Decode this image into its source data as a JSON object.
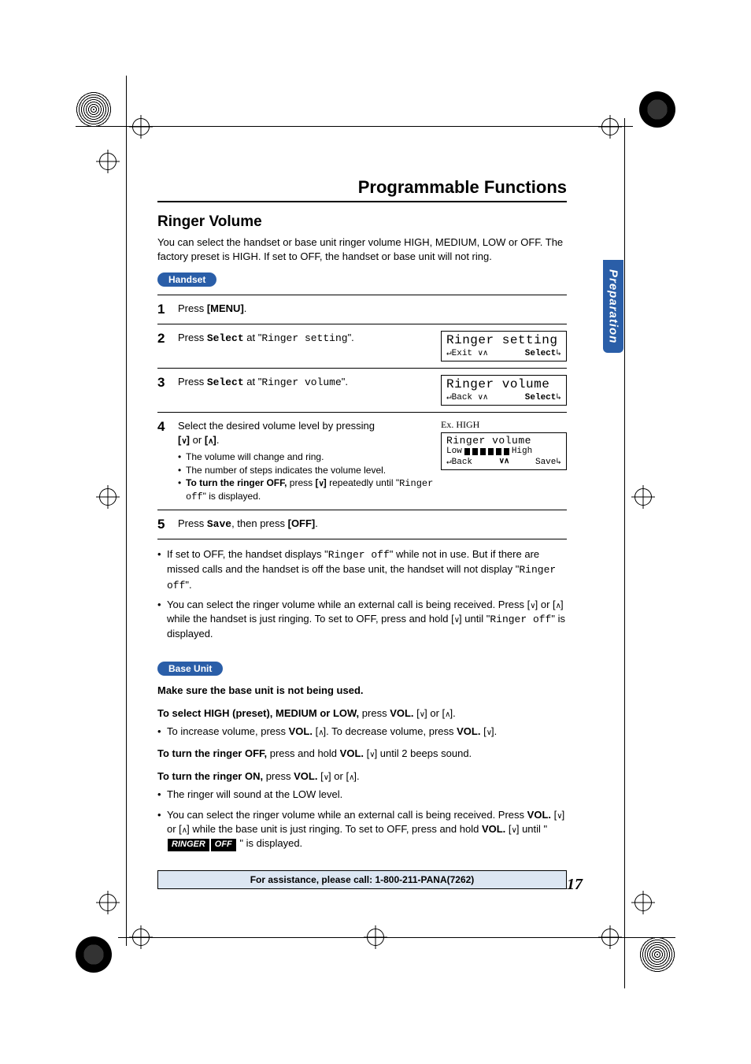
{
  "header": {
    "title": "Programmable Functions"
  },
  "side_tab": "Preparation",
  "section": {
    "title": "Ringer Volume",
    "intro": "You can select the handset or base unit ringer volume HIGH, MEDIUM, LOW or OFF. The factory preset is HIGH. If set to OFF, the handset or base unit will not ring."
  },
  "pill_handset": "Handset",
  "steps": {
    "s1": {
      "num": "1",
      "t1": "Press ",
      "b1": "[MENU]",
      "t2": "."
    },
    "s2": {
      "num": "2",
      "t1": "Press ",
      "b1": "Select",
      "t2": " at \"",
      "m1": "Ringer setting",
      "t3": "\".",
      "lcd_title": "Ringer setting",
      "lcd_left": "Exit",
      "lcd_right": "Select"
    },
    "s3": {
      "num": "3",
      "t1": "Press ",
      "b1": "Select",
      "t2": " at \"",
      "m1": "Ringer volume",
      "t3": "\".",
      "lcd_title": "Ringer volume",
      "lcd_left": "Back",
      "lcd_right": "Select"
    },
    "s4": {
      "num": "4",
      "line1a": "Select the desired volume level by pressing ",
      "line1b": "[",
      "line1c": "]",
      "line1_or": " or ",
      "sub1": "The volume will change and ring.",
      "sub2": "The number of steps indicates the volume level.",
      "sub3a": "To turn the ringer OFF,",
      "sub3b": " press ",
      "sub3c": " repeatedly until \"",
      "sub3d": "Ringer off",
      "sub3e": "\" is displayed.",
      "ex": "Ex. HIGH",
      "lcd_title": "Ringer volume",
      "lcd_low": "Low",
      "lcd_high": "High",
      "lcd_left": "Back",
      "lcd_right": "Save"
    },
    "s5": {
      "num": "5",
      "t1": "Press ",
      "b1": "Save",
      "t2": ", then press ",
      "b2": "[OFF]",
      "t3": "."
    }
  },
  "notes": {
    "n1a": "If set to OFF, the handset displays \"",
    "n1b": "Ringer off",
    "n1c": "\" while not in use. But if there are missed calls and the handset is off the base unit, the handset will not display \"",
    "n1d": "Ringer off",
    "n1e": "\".",
    "n2a": "You can select the ringer volume while an external call is being received. Press ",
    "n2b": " or ",
    "n2c": " while the handset is just ringing. To set to OFF, press and hold ",
    "n2d": " until \"",
    "n2e": "Ringer off",
    "n2f": "\" is displayed."
  },
  "pill_baseunit": "Base Unit",
  "base": {
    "l0": "Make sure the base unit is not being used.",
    "l1a": "To select HIGH (preset), MEDIUM or LOW,",
    "l1b": " press ",
    "l1c": "VOL. ",
    "l1_or": " or ",
    "l2a": "To increase volume, press ",
    "l2b": "VOL. ",
    "l2c": ". To decrease volume, press ",
    "l2d": "VOL. ",
    "l3a": "To turn the ringer OFF,",
    "l3b": " press and hold ",
    "l3c": "VOL. ",
    "l3d": " until 2 beeps sound.",
    "l4a": "To turn the ringer ON,",
    "l4b": " press ",
    "l4c": "VOL. ",
    "l4_or": " or ",
    "l5": "The ringer will sound at the LOW level.",
    "l6a": "You can select the ringer volume while an external call is being received. Press ",
    "l6b": "VOL. ",
    "l6_or": " or ",
    "l6c": " while the base unit is just ringing. To set to OFF, press and hold ",
    "l6d": "VOL. ",
    "l6e": " until \" ",
    "inv1": "RINGER",
    "inv2": "OFF",
    "l6f": " \" is displayed."
  },
  "footer": {
    "text": "For assistance, please call: 1-800-211-PANA(7262)"
  },
  "page_number": "17",
  "glyphs": {
    "down": "∨",
    "up": "∧",
    "arrowL": "↵",
    "arrowR": "↳"
  }
}
